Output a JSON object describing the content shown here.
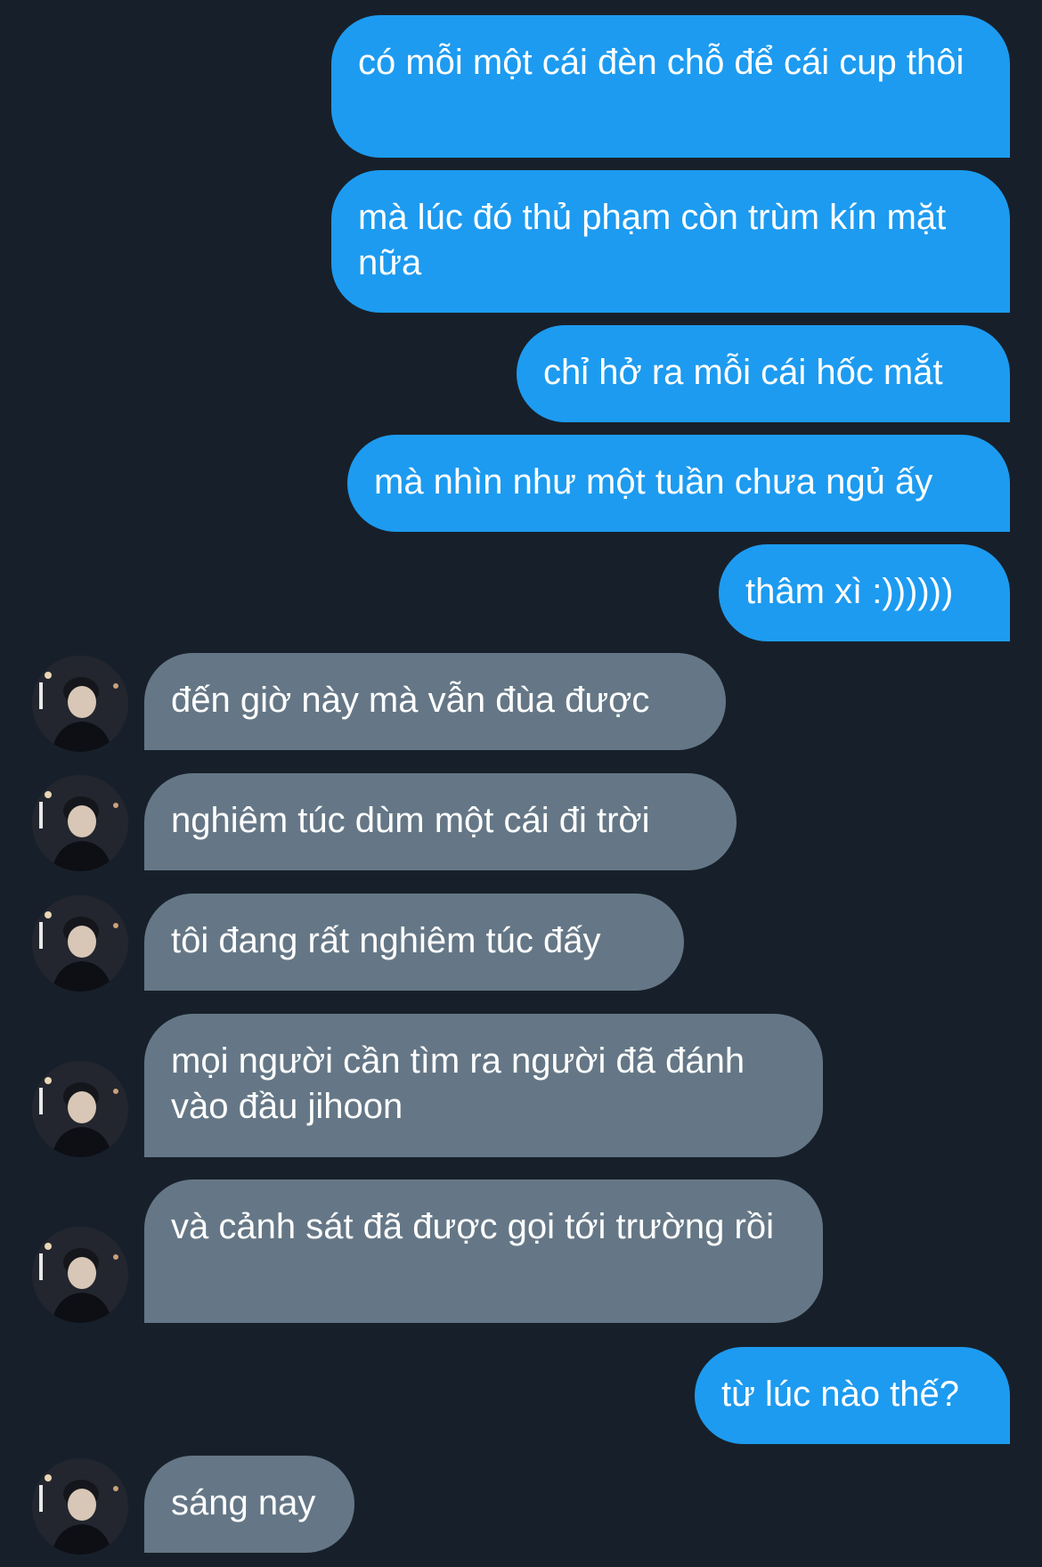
{
  "messages": [
    {
      "side": "sent",
      "text": "có mỗi một cái đèn chỗ để cái cup thôi"
    },
    {
      "side": "sent",
      "text": "mà lúc đó thủ phạm còn trùm kín mặt nữa"
    },
    {
      "side": "sent",
      "text": "chỉ hở ra mỗi cái hốc mắt"
    },
    {
      "side": "sent",
      "text": "mà nhìn như một tuần chưa ngủ ấy"
    },
    {
      "side": "sent",
      "text": "thâm xì :))))))"
    },
    {
      "side": "received",
      "text": "đến giờ này mà vẫn đùa được"
    },
    {
      "side": "received",
      "text": "nghiêm túc dùm một cái đi trời"
    },
    {
      "side": "received",
      "text": "tôi đang rất nghiêm túc đấy"
    },
    {
      "side": "received",
      "text": "mọi người cần tìm ra người đã đánh vào đầu jihoon"
    },
    {
      "side": "received",
      "text": "và cảnh sát đã được gọi tới trường rồi"
    },
    {
      "side": "sent",
      "text": "từ lúc nào thế?"
    },
    {
      "side": "received",
      "text": "sáng nay"
    }
  ],
  "colors": {
    "background": "#17202a",
    "sent_bubble": "#1d9bf0",
    "received_bubble": "#657786",
    "text": "#ffffff"
  },
  "icons": {
    "avatar": "contact-avatar-photo"
  }
}
